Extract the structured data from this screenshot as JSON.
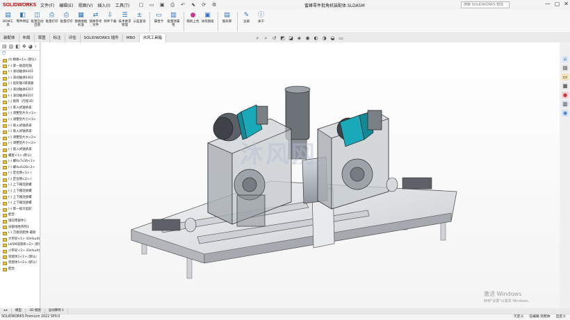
{
  "app": {
    "logo": "SOLIDWORKS",
    "title": "蜜蜂零件批角机装配体.SLDASM"
  },
  "menu": [
    "文件(F)",
    "编辑(E)",
    "视图(V)",
    "插入(I)",
    "工具(T)"
  ],
  "search": {
    "placeholder": "搜索 SOLIDWORKS 帮助"
  },
  "ribbon": [
    {
      "label": "BOM工具",
      "icon": "bom-icon"
    },
    {
      "label": "零件特征",
      "icon": "part-feature-icon"
    },
    {
      "label": "批量自动出图",
      "icon": "batch-drawing-icon"
    },
    {
      "label": "批量打印",
      "icon": "batch-print-icon"
    },
    {
      "label": "批量打印",
      "icon": "print-icon"
    },
    {
      "label": "替换图框标准",
      "icon": "replace-frame-icon"
    },
    {
      "label": "替换参考文件",
      "icon": "replace-ref-icon"
    },
    {
      "label": "附件下载",
      "icon": "download-icon"
    },
    {
      "label": "技术要求管理",
      "icon": "tech-req-icon"
    },
    {
      "label": "公差查询",
      "icon": "tolerance-icon"
    },
    {
      "label": "属性卡",
      "icon": "property-card-icon"
    },
    {
      "label": "批量改属性",
      "icon": "batch-property-icon"
    },
    {
      "label": "随机上色",
      "icon": "random-color-icon"
    },
    {
      "label": "沐风图纸",
      "icon": "mufeng-drawing-icon"
    },
    {
      "label": "图形库",
      "icon": "library-icon"
    },
    {
      "label": "注册",
      "icon": "register-icon"
    },
    {
      "label": "关于",
      "icon": "about-icon"
    }
  ],
  "tabs": [
    "装配体",
    "布局",
    "草图",
    "标注",
    "评估",
    "SOLIDWORKS 插件",
    "MBD",
    "沐风工具箱"
  ],
  "active_tab": "沐风工具箱",
  "tree": [
    "(f) 精端<1> (默认)",
    "(-) 第一级齿轮轴",
    "(-) 滚动轴承6302",
    "(-) 滚动轴承6302",
    "(-) 齿轮轴3减速器",
    "(-) 滚动轴承6207",
    "(-) 滚动轴承6207",
    "(-) 套筒（内径35）",
    "(-) 嵌入式轴承盖",
    "(-) 调整垫片大<1>",
    "(-) 调整垫片小<1>",
    "(-) 嵌入式轴承盖",
    "(-) 嵌入式轴承盖",
    "(-) 调整垫片大<2>",
    "(-) 调整垫片小<2>",
    "(-) 嵌入式轴承盖",
    "螺套<1> (默认)",
    "(-) 螺6x7x36<1>",
    "(-) 螺4x4x28<2>",
    "(-) 定位销<1> (",
    "(-) 定位销<2> (",
    "(-) 上下箱连接螺",
    "(-) 上下箱连接螺",
    "(-) 上下箱连接螺",
    "(-) 上下箱连接螺",
    "(-) 第一级大齿轮",
    "配合",
    "镜向零部件1",
    "局部线性阵列1",
    "(-) 刀盘装配体-最新",
    "大带轮<1> (Default)",
    "LKSM减速机<2> (默认)",
    "小带轮<2> (Default)",
    "装配体1<1> (默认)",
    "装配体1<2> (默认)",
    "配合"
  ],
  "bottom_tabs": [
    "模型",
    "3D 视图",
    "运动算例 1"
  ],
  "status": {
    "left": "SOLIDWORKS Premium 2022 SP0.0",
    "r1": "欠定义",
    "r2": "在编辑 装配体",
    "r3": "自定义"
  },
  "activate": {
    "title": "激活 Windows",
    "sub": "转到\"设置\"以激活 Windows。"
  },
  "watermark": {
    "text": "沐风网",
    "url": "www.mfcad.com"
  },
  "colors": {
    "accent": "#d40000",
    "teal": "#1aa9b8",
    "frame": "#9aa0a6"
  }
}
